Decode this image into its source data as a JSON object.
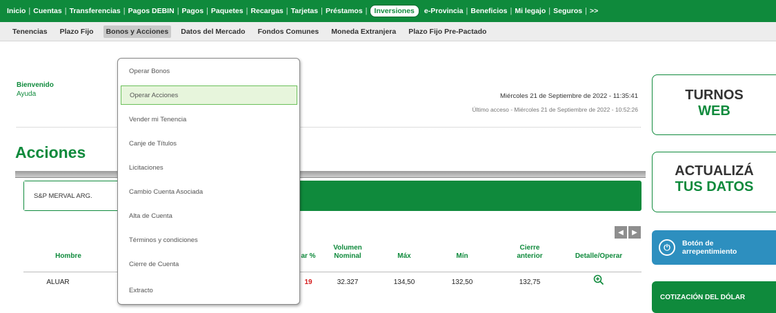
{
  "topnav": {
    "items": [
      "Inicio",
      "Cuentas",
      "Transferencias",
      "Pagos DEBIN",
      "Pagos",
      "Paquetes",
      "Recargas",
      "Tarjetas",
      "Préstamos",
      "Inversiones",
      "e-Provincia",
      "Beneficios",
      "Mi legajo",
      "Seguros",
      ">>"
    ],
    "active": "Inversiones"
  },
  "subnav": {
    "items": [
      "Tenencias",
      "Plazo Fijo",
      "Bonos y Acciones",
      "Datos del Mercado",
      "Fondos Comunes",
      "Moneda Extranjera",
      "Plazo Fijo Pre-Pactado"
    ],
    "active": "Bonos y Acciones"
  },
  "welcome": {
    "title": "Bienvenido",
    "help": "Ayuda"
  },
  "datetime": "Miércoles 21 de Septiembre de 2022 - 11:35:41",
  "last_access": "Último acceso - Miércoles 21 de Septiembre de 2022 - 10:52:26",
  "page_title": "Acciones",
  "index_tab": "S&P MERVAL ARG.",
  "arrows": {
    "prev": "◀",
    "next": "▶"
  },
  "table": {
    "headers": [
      "Hombre",
      "ar %",
      "Volumen Nominal",
      "Máx",
      "Mín",
      "Cierre anterior",
      "Detalle/Operar"
    ],
    "rows": [
      {
        "name": "ALUAR",
        "var": "19",
        "volume": "32.327",
        "max": "134,50",
        "min": "132,50",
        "close": "132,75"
      }
    ]
  },
  "dropdown": {
    "items": [
      "Operar Bonos",
      "Operar Acciones",
      "Vender mi Tenencia",
      "Canje de Títulos",
      "Licitaciones",
      "Cambio Cuenta Asociada",
      "Alta de Cuenta",
      "Términos y condiciones",
      "Cierre de Cuenta",
      "Extracto"
    ],
    "highlighted": "Operar Acciones"
  },
  "panels": {
    "turnos": {
      "line1": "TURNOS",
      "line2": "WEB"
    },
    "actualiza": {
      "line1": "ACTUALIZÁ",
      "line2": "TUS DATOS"
    },
    "boton": {
      "line1": "Botón de",
      "line2": "arrepentimiento"
    },
    "cotizacion": "COTIZACIÓN DEL DÓLAR"
  },
  "colors": {
    "brand_green": "#0f8a3c",
    "negative_red": "#d41a1a",
    "info_blue": "#2d8fbf"
  }
}
